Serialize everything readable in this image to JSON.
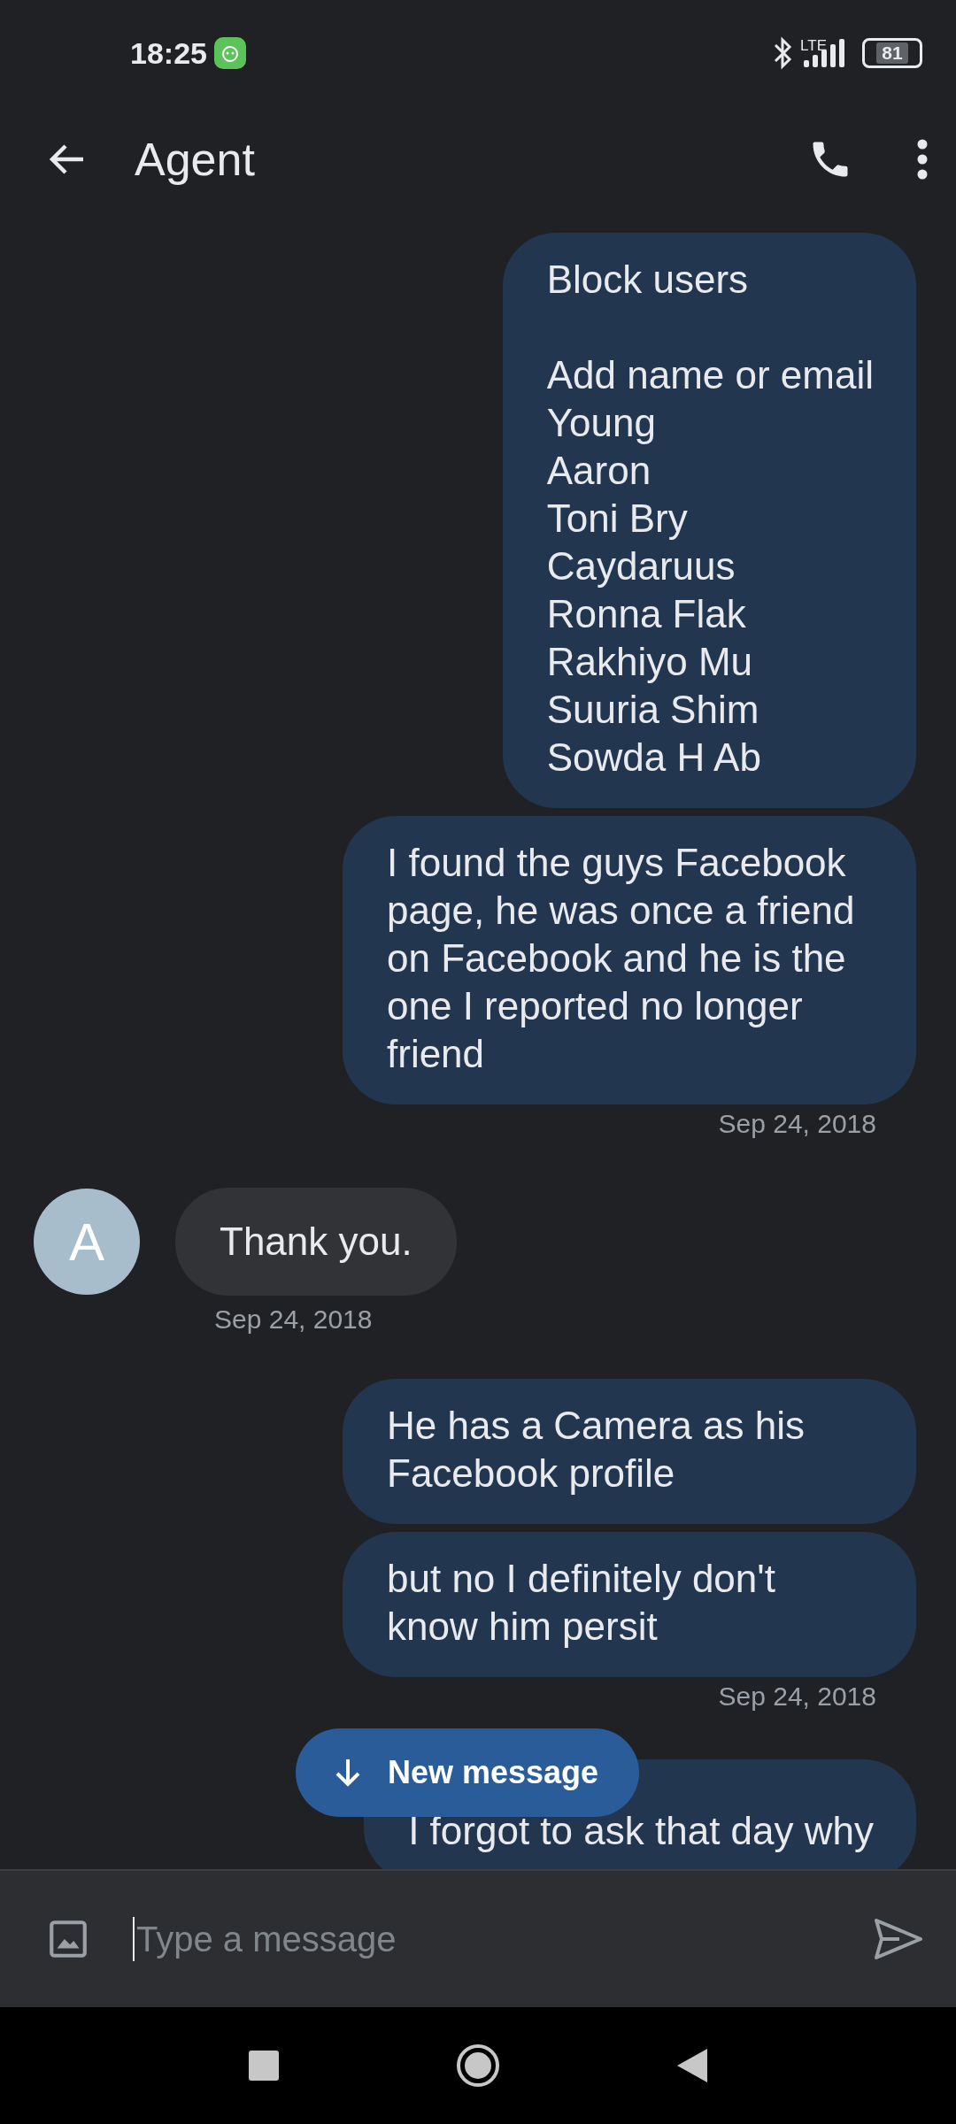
{
  "status_bar": {
    "time": "18:25",
    "network": "LTE",
    "battery": "81"
  },
  "app_bar": {
    "title": "Agent"
  },
  "messages": [
    {
      "kind": "sent",
      "text": "Block users\n\nAdd name or email\nYoung\nAaron\nToni Bry\nCaydaruus\nRonna Flak\nRakhiyo Mu\nSuuria Shim\nSowda H Ab"
    },
    {
      "kind": "sent",
      "text": "I found the guys Facebook page, he was once a friend on Facebook and he is the one I reported no longer friend",
      "timestamp": "Sep 24, 2018"
    },
    {
      "kind": "received",
      "avatar": "A",
      "text": "Thank you.",
      "timestamp": "Sep 24, 2018"
    },
    {
      "kind": "sent",
      "text": "He has a Camera as his Facebook profile"
    },
    {
      "kind": "sent",
      "text": "but no I definitely don't know him persit",
      "timestamp": "Sep 24, 2018"
    },
    {
      "kind": "sent",
      "text": "I forgot to ask that day why"
    }
  ],
  "new_message_button": {
    "label": "New message"
  },
  "composer": {
    "placeholder": "Type a message"
  }
}
